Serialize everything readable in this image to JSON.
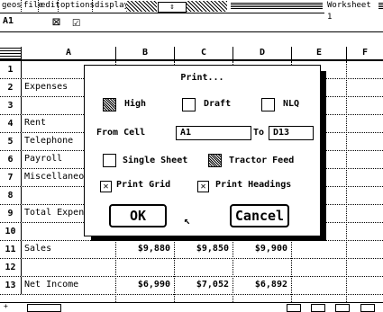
{
  "menu": {
    "items": [
      "geos",
      "file",
      "edit",
      "options",
      "display"
    ]
  },
  "window": {
    "title": "Worksheet 1",
    "scroll_arrows": "⇕"
  },
  "cellbar": {
    "ref": "A1",
    "cancel_icon": "⊠",
    "accept_icon": "☑"
  },
  "columns": [
    "A",
    "B",
    "C",
    "D",
    "E",
    "F"
  ],
  "rows": [
    {
      "n": "1",
      "label": ""
    },
    {
      "n": "2",
      "label": "Expenses"
    },
    {
      "n": "3",
      "label": ""
    },
    {
      "n": "4",
      "label": "Rent"
    },
    {
      "n": "5",
      "label": "Telephone"
    },
    {
      "n": "6",
      "label": "Payroll"
    },
    {
      "n": "7",
      "label": "Miscellaneous"
    },
    {
      "n": "8",
      "label": ""
    },
    {
      "n": "9",
      "label": "Total Expenses"
    },
    {
      "n": "10",
      "label": ""
    },
    {
      "n": "11",
      "label": "Sales",
      "b": "$9,880",
      "c": "$9,850",
      "d": "$9,900"
    },
    {
      "n": "12",
      "label": ""
    },
    {
      "n": "13",
      "label": "Net Income",
      "b": "$6,990",
      "c": "$7,052",
      "d": "$6,892"
    }
  ],
  "dialog": {
    "title": "Print...",
    "quality": {
      "high": "High",
      "draft": "Draft",
      "nlq": "NLQ"
    },
    "from_cell_label": "From Cell",
    "from_value": "A1",
    "to_label": "To",
    "to_value": "D13",
    "single_sheet": "Single Sheet",
    "tractor_feed": "Tractor Feed",
    "print_grid": "Print Grid",
    "print_headings": "Print Headings",
    "ok": "OK",
    "cancel": "Cancel"
  }
}
